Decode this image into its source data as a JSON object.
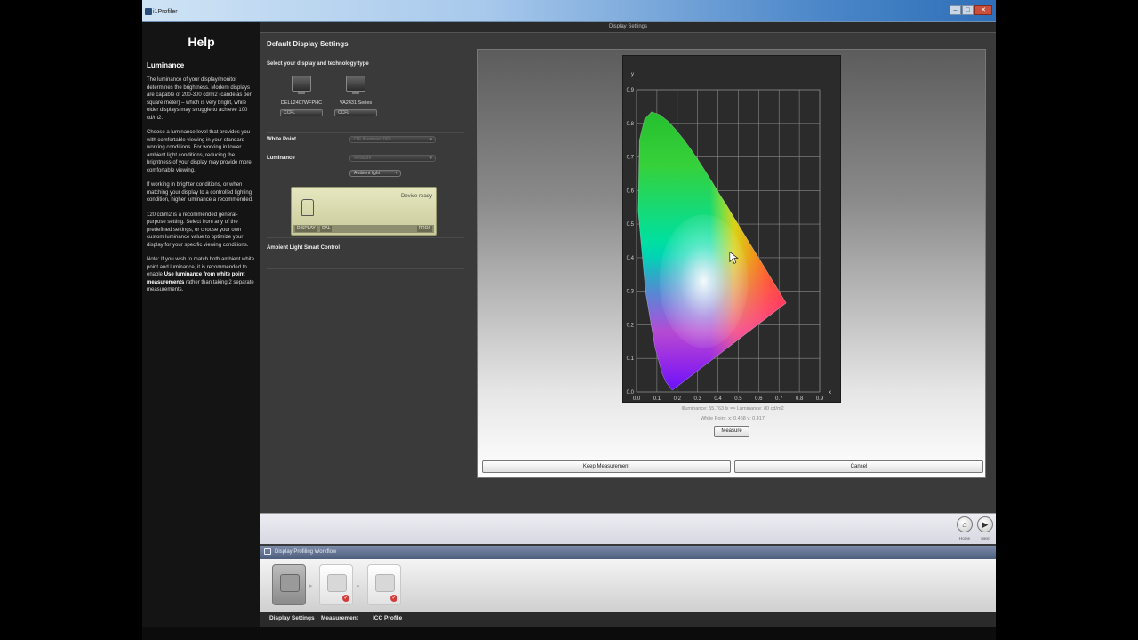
{
  "window": {
    "title": "i1Profiler",
    "buttons": [
      "–",
      "□",
      "✕"
    ]
  },
  "header": {
    "title": "Display Settings"
  },
  "help": {
    "title": "Help",
    "section": "Luminance",
    "paragraphs": [
      "The luminance of your display/monitor determines the brightness. Modern displays are capable of 200-300 cd/m2 (candelas per square meter) – which is very bright, while older displays may struggle to achieve 100 cd/m2.",
      "Choose a luminance level that provides you with comfortable viewing in your standard working conditions. For working in lower ambient light conditions, reducing the brightness of your display may provide more comfortable viewing.",
      "If working in brighter conditions, or when matching your display to a controlled lighting condition, higher luminance a recommended.",
      "120 cd/m2 is a recommended general-purpose setting. Select from any of the predefined settings, or choose your own custom luminance value to optimize your display for your specific viewing conditions."
    ],
    "note_prefix": "Note: If you wish to match both ambient white point and luminance, it is recommended to enable ",
    "note_bold": "Use luminance from white point measurements",
    "note_suffix": " rather than taking 2 separate measurements."
  },
  "settings": {
    "title": "Default Display Settings",
    "select_label": "Select your display and technology type",
    "displays": [
      {
        "name": "DELL2407WFPHC",
        "tech": "CCFL"
      },
      {
        "name": "VA2431 Series",
        "tech": "CCFL"
      }
    ],
    "white_point_label": "White Point",
    "white_point_value": "CIE Illuminant D65",
    "luminance_label": "Luminance",
    "luminance_value": "Measure",
    "ambient_value": "Ambient light",
    "device_status": "Device ready",
    "device_tabs": [
      "DISPLAY",
      "CAL"
    ],
    "device_tab_right": "PROJ",
    "ambient_control_label": "Ambient Light Smart Control"
  },
  "chart_data": {
    "type": "scatter",
    "title": "",
    "xlabel": "x",
    "ylabel": "y",
    "xlim": [
      0.0,
      0.9
    ],
    "ylim": [
      0.0,
      0.9
    ],
    "xticks": [
      "0.0",
      "0.1",
      "0.2",
      "0.3",
      "0.4",
      "0.5",
      "0.6",
      "0.7",
      "0.8",
      "0.9"
    ],
    "yticks": [
      "0.0",
      "0.1",
      "0.2",
      "0.3",
      "0.4",
      "0.5",
      "0.6",
      "0.7",
      "0.8",
      "0.9"
    ],
    "grid": true,
    "spectral_locus": {
      "x": [
        0.175,
        0.144,
        0.124,
        0.091,
        0.045,
        0.008,
        0.014,
        0.039,
        0.074,
        0.114,
        0.155,
        0.193,
        0.23,
        0.266,
        0.302,
        0.337,
        0.373,
        0.408,
        0.444,
        0.479,
        0.512,
        0.545,
        0.575,
        0.603,
        0.627,
        0.647,
        0.664,
        0.677,
        0.688,
        0.735
      ],
      "y": [
        0.005,
        0.03,
        0.058,
        0.133,
        0.295,
        0.538,
        0.75,
        0.812,
        0.834,
        0.826,
        0.806,
        0.781,
        0.754,
        0.724,
        0.692,
        0.659,
        0.624,
        0.589,
        0.555,
        0.52,
        0.487,
        0.454,
        0.424,
        0.397,
        0.373,
        0.353,
        0.336,
        0.323,
        0.312,
        0.265
      ]
    },
    "white_point_marker": {
      "x": 0.458,
      "y": 0.417
    }
  },
  "readout": {
    "illuminance": "Illuminance: 55.763 lx  =>  Luminance: 80 cd/m2",
    "white_point": "White Point: x: 0.458  y: 0.417"
  },
  "buttons": {
    "measure": "Measure",
    "keep": "Keep Measurement",
    "cancel": "Cancel",
    "home_label": "Home",
    "next_label": "Next",
    "home_icon": "home-icon",
    "next_icon": "play-icon"
  },
  "workflow": {
    "title": "Display Profiling Workflow",
    "steps": [
      "Display Settings",
      "Measurement",
      "ICC Profile"
    ]
  }
}
